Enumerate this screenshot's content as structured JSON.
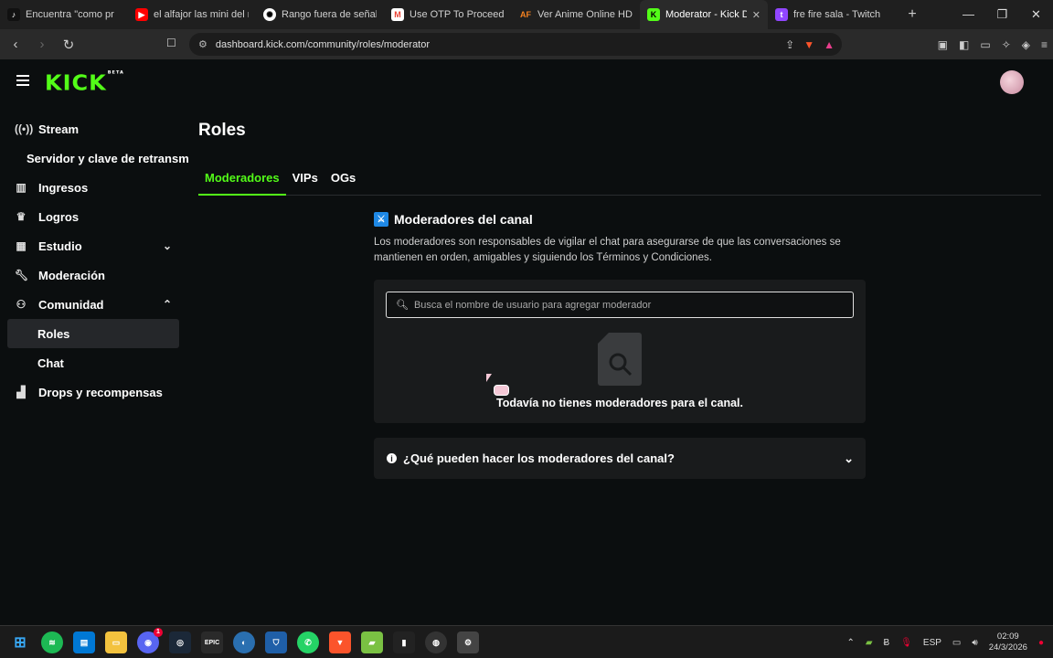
{
  "browser": {
    "tabs": [
      {
        "title": "Encuentra \"como pr",
        "favicon": "tiktok-icon",
        "color": "#111111"
      },
      {
        "title": "el alfajor las mini del m",
        "favicon": "youtube-icon",
        "color": "#ff0000"
      },
      {
        "title": "Rango fuera de señal",
        "favicon": "openai-icon",
        "color": "#ffffff"
      },
      {
        "title": "Use OTP To Proceed - b",
        "favicon": "gmail-icon",
        "color": "#ea4335"
      },
      {
        "title": "Ver Anime Online HD -",
        "favicon": "animeflv-icon",
        "color": "#f58220"
      },
      {
        "title": "Moderator - Kick D",
        "favicon": "kick-icon",
        "color": "#53fc18",
        "active": true
      },
      {
        "title": "fre fire sala - Twitch",
        "favicon": "twitch-icon",
        "color": "#9146ff"
      }
    ],
    "url": "dashboard.kick.com/community/roles/moderator"
  },
  "header": {
    "logo": "KICK",
    "logo_badge": "BETA"
  },
  "sidebar": {
    "items": [
      {
        "label": "Stream",
        "icon": "broadcast-icon"
      },
      {
        "label": "Servidor y clave de retransm"
      },
      {
        "label": "Ingresos",
        "icon": "chart-icon"
      },
      {
        "label": "Logros",
        "icon": "trophy-icon"
      },
      {
        "label": "Estudio",
        "icon": "layout-icon",
        "chevron": "down"
      },
      {
        "label": "Moderación",
        "icon": "wrench-icon"
      },
      {
        "label": "Comunidad",
        "icon": "users-icon",
        "chevron": "up"
      },
      {
        "label": "Roles",
        "selected": true
      },
      {
        "label": "Chat"
      },
      {
        "label": "Drops y recompensas",
        "icon": "gift-icon"
      }
    ]
  },
  "main": {
    "title": "Roles",
    "tabs": [
      "Moderadores",
      "VIPs",
      "OGs"
    ],
    "section_title": "Moderadores del canal",
    "section_description": "Los moderadores son responsables de vigilar el chat para asegurarse de que las conversaciones se mantienen en orden, amigables y siguiendo los Términos y Condiciones.",
    "search_placeholder": "Busca el nombre de usuario para agregar moderador",
    "empty_text": "Todavía no tienes moderadores para el canal.",
    "faq_label": "¿Qué pueden hacer los moderadores del canal?"
  },
  "taskbar": {
    "discord_badge": "1",
    "language": "ESP",
    "time": "02:09",
    "date": "24/3/2026"
  },
  "colors": {
    "accent": "#53fc18",
    "background": "#0b0e0f",
    "panel": "#191b1c"
  }
}
